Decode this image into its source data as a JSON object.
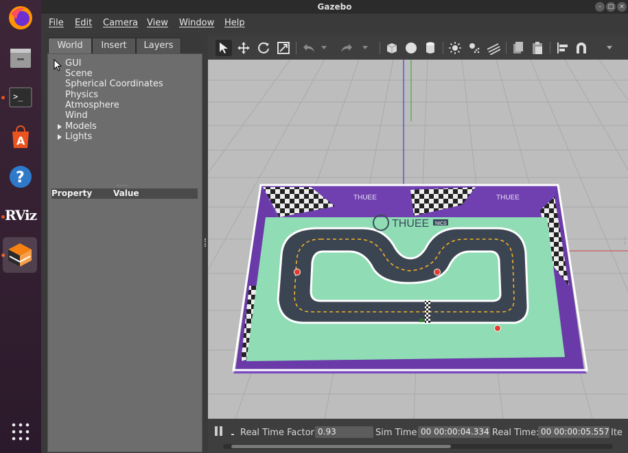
{
  "window": {
    "title": "Gazebo"
  },
  "menu": [
    "File",
    "Edit",
    "Camera",
    "View",
    "Window",
    "Help"
  ],
  "dock": [
    "firefox-icon",
    "files-icon",
    "terminal-icon",
    "software-store-icon",
    "help-icon",
    "rviz-icon",
    "gazebo-icon",
    "app-grid-icon"
  ],
  "rviz_logo_text": "RViz",
  "tabs": [
    "World",
    "Insert",
    "Layers"
  ],
  "tree": {
    "root": "GUI",
    "items": [
      "Scene",
      "Spherical Coordinates",
      "Physics",
      "Atmosphere",
      "Wind"
    ],
    "expandable": [
      "Models",
      "Lights"
    ]
  },
  "property_table": {
    "col1": "Property",
    "col2": "Value"
  },
  "toolbar": [
    "select-arrow-icon",
    "translate-icon",
    "rotate-icon",
    "scale-icon",
    "undo-icon",
    "redo-icon",
    "box-icon",
    "sphere-icon",
    "cylinder-icon",
    "point-light-icon",
    "spot-light-icon",
    "directional-light-icon",
    "copy-icon",
    "paste-icon",
    "align-icon",
    "snap-icon"
  ],
  "status": {
    "rtf_label": "Real Time Factor:",
    "rtf_value": "0.93",
    "sim_label": "Sim Time:",
    "sim_value": "00 00:00:04.334",
    "real_label": "Real Time:",
    "real_value": "00 00:00:05.557",
    "iter_label": "Ite"
  },
  "scene": {
    "brand": "THUEE",
    "brand_sub": "NICS"
  },
  "colors": {
    "accent": "#e95420",
    "track": "#3b4451",
    "field": "#8fdcb5",
    "wall": "#5a2a9c"
  }
}
